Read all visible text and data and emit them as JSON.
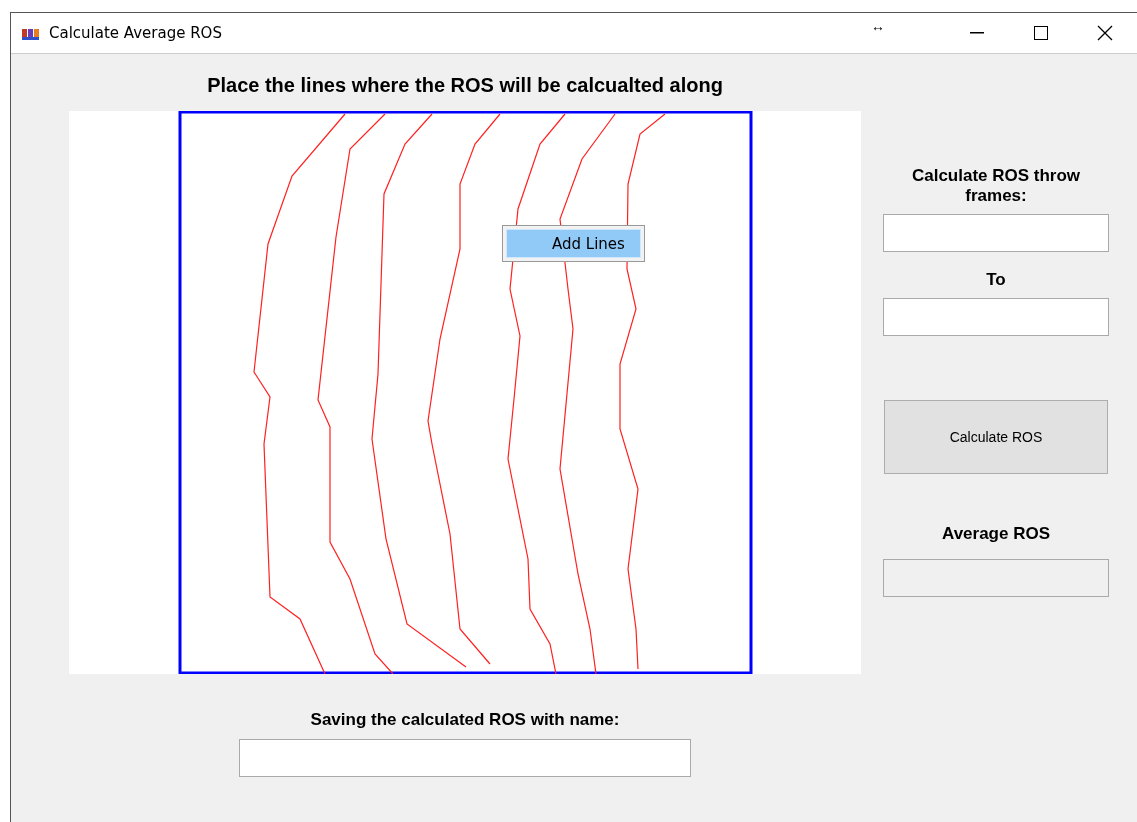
{
  "window": {
    "title": "Calculate Average ROS",
    "caption_buttons": [
      "↔"
    ]
  },
  "heading": "Place the lines where the ROS will be calcualted along",
  "context_menu": {
    "items": [
      {
        "label": "Add Lines",
        "selected": true
      }
    ]
  },
  "frames": {
    "label": "Calculate ROS throw frames:",
    "to_label": "To"
  },
  "calculate_button": "Calculate ROS",
  "average": {
    "label": "Average ROS"
  },
  "save": {
    "label": "Saving the calculated ROS with name:"
  }
}
